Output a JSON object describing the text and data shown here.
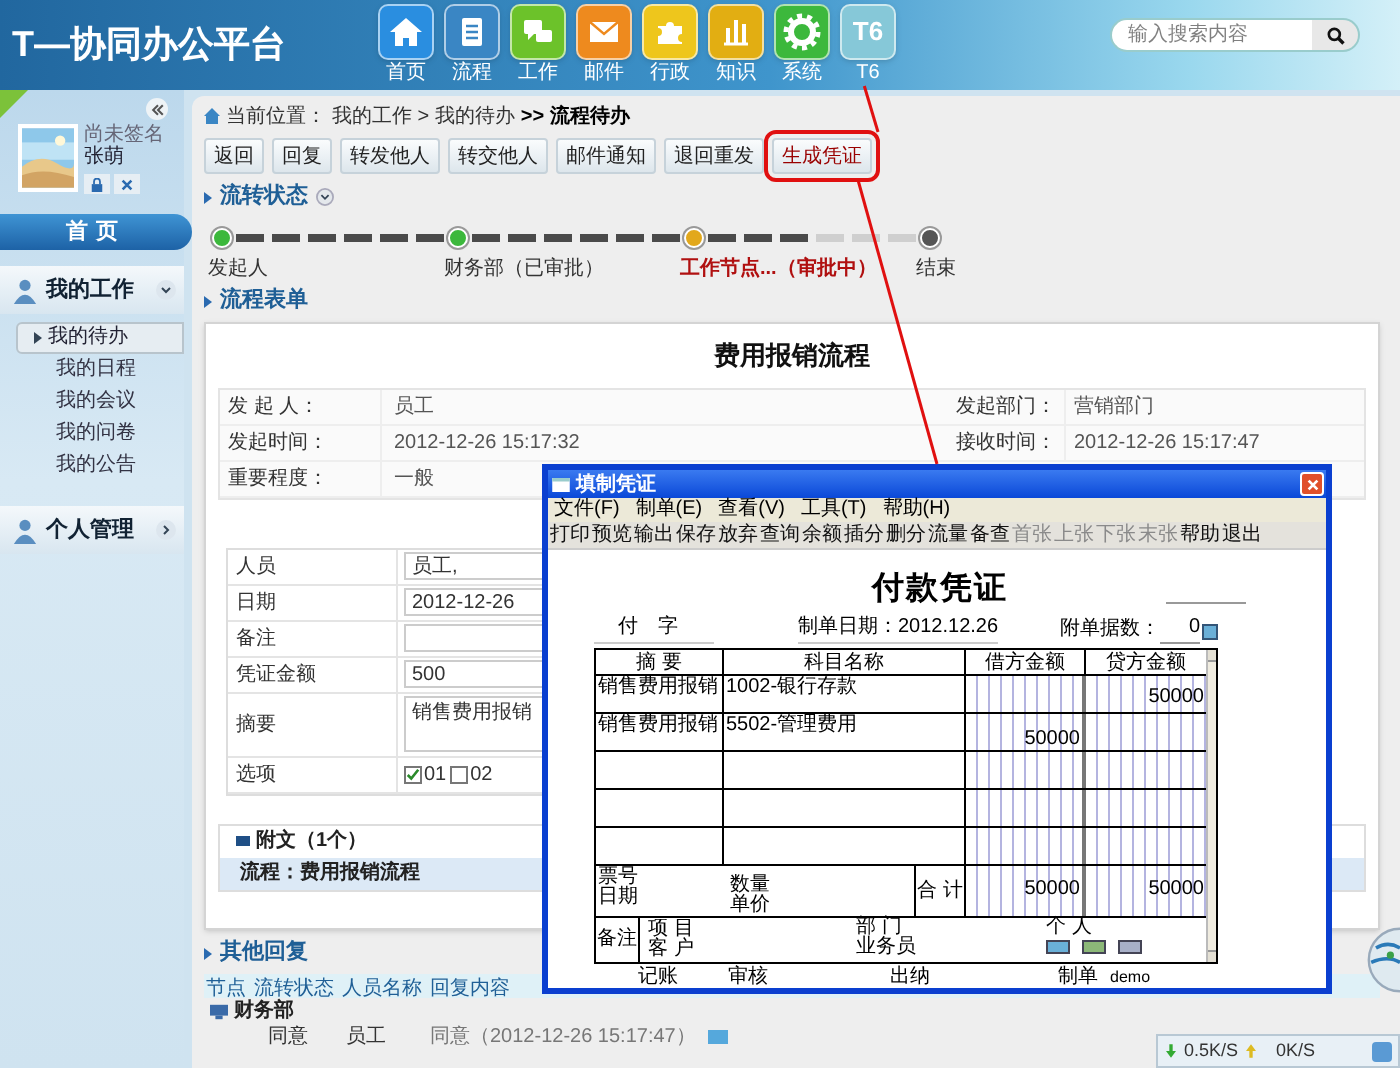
{
  "app": {
    "title": "T—协同办公平台"
  },
  "nav": [
    {
      "label": "首页",
      "kind": "home",
      "color": "#2a8ee0"
    },
    {
      "label": "流程",
      "kind": "notebook",
      "color": "#3a86c4"
    },
    {
      "label": "工作",
      "kind": "chat",
      "color": "#6cc22a"
    },
    {
      "label": "邮件",
      "kind": "mail",
      "color": "#ee8a1e"
    },
    {
      "label": "行政",
      "kind": "puzzle",
      "color": "#eec61c"
    },
    {
      "label": "知识",
      "kind": "bars",
      "color": "#e2ae12"
    },
    {
      "label": "系统",
      "kind": "gear",
      "color": "#3cb83c"
    },
    {
      "label": "T6",
      "kind": "text",
      "icon_text": "T6",
      "color": "#86c8d8"
    }
  ],
  "search": {
    "placeholder": "输入搜索内容"
  },
  "user": {
    "signature": "尚未签名",
    "name": "张萌"
  },
  "sidebar": {
    "home": "首页",
    "sections": [
      {
        "title": "我的工作",
        "expanded": true,
        "items": [
          {
            "label": "我的待办",
            "selected": true
          },
          {
            "label": "我的日程",
            "selected": false
          },
          {
            "label": "我的会议",
            "selected": false
          },
          {
            "label": "我的问卷",
            "selected": false
          },
          {
            "label": "我的公告",
            "selected": false
          }
        ]
      },
      {
        "title": "个人管理",
        "expanded": false
      }
    ]
  },
  "breadcrumb": {
    "label": "当前位置：",
    "path": "我的工作 > 我的待办",
    "current": ">> 流程待办"
  },
  "actions": [
    {
      "label": "返回",
      "highlighted": false
    },
    {
      "label": "回复",
      "highlighted": false
    },
    {
      "label": "转发他人",
      "highlighted": false
    },
    {
      "label": "转交他人",
      "highlighted": false
    },
    {
      "label": "邮件通知",
      "highlighted": false
    },
    {
      "label": "退回重发",
      "highlighted": false
    },
    {
      "label": "生成凭证",
      "highlighted": true
    }
  ],
  "flow": {
    "title": "流转状态",
    "steps": [
      {
        "label": "发起人",
        "kind": "done"
      },
      {
        "label": "财务部（已审批）",
        "kind": "done"
      },
      {
        "label": "工作节点...（审批中）",
        "kind": "current"
      },
      {
        "label": "结束",
        "kind": "pending"
      }
    ]
  },
  "form": {
    "section_title": "流程表单",
    "title": "费用报销流程",
    "info": [
      {
        "label": "发 起 人：",
        "value": "员工",
        "label2": "发起部门：",
        "value2": "营销部门"
      },
      {
        "label": "发起时间：",
        "value": "2012-12-26 15:17:32",
        "label2": "接收时间：",
        "value2": "2012-12-26 15:17:47"
      },
      {
        "label": "重要程度：",
        "value": "一般"
      }
    ],
    "fields": [
      {
        "kind": "text",
        "label": "人员",
        "value": "员工,"
      },
      {
        "kind": "text",
        "label": "日期",
        "value": "2012-12-26"
      },
      {
        "kind": "text",
        "label": "备注"
      },
      {
        "kind": "text",
        "label": "凭证金额",
        "value": "500"
      },
      {
        "kind": "textarea",
        "label": "摘要",
        "value": "销售费用报销"
      },
      {
        "kind": "checks",
        "label": "选项",
        "options": [
          {
            "label": "01",
            "checked": true
          },
          {
            "label": "02",
            "checked": false
          }
        ]
      }
    ],
    "attachments": {
      "title": "附文（1个）",
      "item": "流程：费用报销流程"
    }
  },
  "replies": {
    "title": "其他回复",
    "columns": [
      "节点",
      "流转状态",
      "人员名称",
      "回复内容"
    ],
    "groups": [
      {
        "name": "财务部",
        "rows": [
          {
            "state": "同意",
            "person": "员工",
            "content": "同意（2012-12-26 15:17:47）"
          }
        ]
      }
    ]
  },
  "dialog": {
    "title": "填制凭证",
    "menu": [
      "文件(F)",
      "制单(E)",
      "查看(V)",
      "工具(T)",
      "帮助(H)"
    ],
    "toolbar": [
      {
        "label": "打印",
        "disabled": false
      },
      {
        "label": "预览",
        "disabled": false
      },
      {
        "label": "输出",
        "disabled": false
      },
      {
        "label": "保存",
        "disabled": false
      },
      {
        "label": "放弃",
        "disabled": false
      },
      {
        "label": "查询",
        "disabled": false
      },
      {
        "label": "余额",
        "disabled": false
      },
      {
        "label": "插分",
        "disabled": false
      },
      {
        "label": "删分",
        "disabled": false
      },
      {
        "label": "流量",
        "disabled": false
      },
      {
        "label": "备查",
        "disabled": false
      },
      {
        "label": "首张",
        "disabled": true
      },
      {
        "label": "上张",
        "disabled": true
      },
      {
        "label": "下张",
        "disabled": true
      },
      {
        "label": "末张",
        "disabled": true
      },
      {
        "label": "帮助",
        "disabled": false
      },
      {
        "label": "退出",
        "disabled": false
      }
    ],
    "voucher": {
      "title": "付款凭证",
      "type_label": "付　字",
      "date": "制单日期：2012.12.26",
      "attachments_label": "附单据数：",
      "attachments": "0",
      "columns": [
        "摘 要",
        "科目名称",
        "借方金额",
        "贷方金额"
      ],
      "rows": [
        {
          "summary": "销售费用报销",
          "account": "1002-银行存款",
          "credit": "50000"
        },
        {
          "summary": "销售费用报销",
          "account": "5502-管理费用",
          "debit": "50000"
        }
      ],
      "totals": {
        "ticket": "票号",
        "date": "日期",
        "quantity": "数量",
        "price": "单价",
        "label": "合 计",
        "debit": "50000",
        "credit": "50000"
      },
      "notes": {
        "label": "备注",
        "item": "项 目",
        "customer": "客 户",
        "department": "部 门",
        "staff": "业务员",
        "person": "个 人"
      },
      "signatures": [
        {
          "label": "记账"
        },
        {
          "label": "审核"
        },
        {
          "label": "出纳"
        },
        {
          "label": "制单",
          "value": "demo"
        }
      ]
    }
  },
  "status_bar": {
    "down": "0.5K/S",
    "up": "0K/S"
  }
}
